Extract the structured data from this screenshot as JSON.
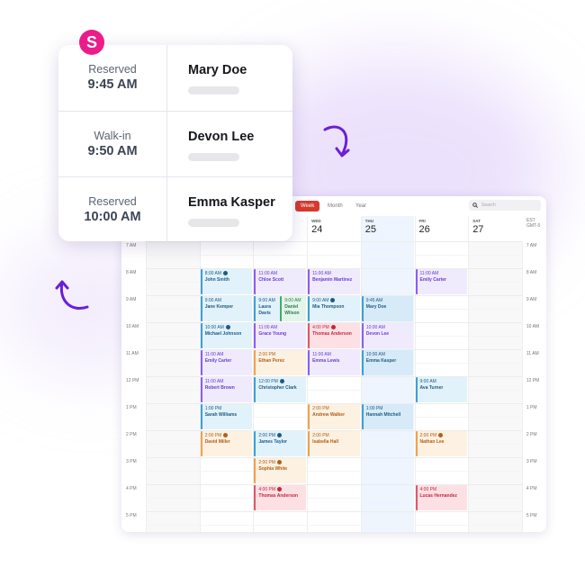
{
  "brand": {
    "logo_letter": "S",
    "logo_color": "#ec1c8a",
    "accent": "#6a1fd6"
  },
  "card": {
    "rows": [
      {
        "kind": "Reserved",
        "time": "9:45 AM",
        "name": "Mary Doe"
      },
      {
        "kind": "Walk-in",
        "time": "9:50 AM",
        "name": "Devon Lee"
      },
      {
        "kind": "Reserved",
        "time": "10:00 AM",
        "name": "Emma Kasper"
      }
    ]
  },
  "calendar": {
    "views": [
      {
        "label": "Week",
        "active": true
      },
      {
        "label": "Month"
      },
      {
        "label": "Year"
      }
    ],
    "search_placeholder": "Search",
    "timezone": [
      "EST",
      "GMT-5"
    ],
    "days": [
      {
        "name": "",
        "date": "",
        "shade": "grey"
      },
      {
        "name": "",
        "date": ""
      },
      {
        "name": "",
        "date": ""
      },
      {
        "name": "WED",
        "date": "24"
      },
      {
        "name": "THU",
        "date": "25",
        "today": true
      },
      {
        "name": "FRI",
        "date": "26"
      },
      {
        "name": "SAT",
        "date": "27",
        "shade": "grey"
      }
    ],
    "hours": [
      "7 AM",
      "8 AM",
      "9 AM",
      "10 AM",
      "11 AM",
      "12 PM",
      "1 PM",
      "2 PM",
      "3 PM",
      "4 PM",
      "5 PM"
    ],
    "colors": {
      "blue": {
        "bg": "#e1f2fb",
        "border": "#3d9fd8",
        "text": "#1f5a88"
      },
      "purple": {
        "bg": "#efeafc",
        "border": "#8b5cf6",
        "text": "#6a3fcf"
      },
      "orange": {
        "bg": "#fdf1e1",
        "border": "#efa14e",
        "text": "#b0601a"
      },
      "red": {
        "bg": "#fde0e4",
        "border": "#e0566a",
        "text": "#c0283d"
      },
      "green": {
        "bg": "#e3f5ea",
        "border": "#3fae6a",
        "text": "#2d7d4c"
      }
    },
    "events": [
      {
        "day": 1,
        "slot": "8 AM",
        "time": "8:00 AM",
        "name": "John Smith",
        "color": "blue",
        "icon": true
      },
      {
        "day": 1,
        "slot": "9 AM",
        "time": "9:00 AM",
        "name": "Jane Kemper",
        "color": "blue"
      },
      {
        "day": 1,
        "slot": "10 AM",
        "time": "10:00 AM",
        "name": "Michael Johnson",
        "color": "blue",
        "icon": true
      },
      {
        "day": 1,
        "slot": "11 AM",
        "time": "11:00 AM",
        "name": "Emily Carter",
        "color": "purple"
      },
      {
        "day": 1,
        "slot": "12 PM",
        "time": "11:00 AM",
        "name": "Robert Brown",
        "color": "purple"
      },
      {
        "day": 1,
        "slot": "1 PM",
        "time": "1:00 PM",
        "name": "Sarah Williams",
        "color": "blue"
      },
      {
        "day": 1,
        "slot": "2 PM",
        "time": "2:00 PM",
        "name": "David Miller",
        "color": "orange",
        "icon": true
      },
      {
        "day": 2,
        "slot": "8 AM",
        "time": "11:00 AM",
        "name": "Chloe Scott",
        "color": "purple"
      },
      {
        "day": 2,
        "slot": "9 AM",
        "time": "9:00 AM",
        "name": "Laura Davis",
        "color": "blue",
        "half": "left"
      },
      {
        "day": 2,
        "slot": "9 AM",
        "time": "9:00 AM",
        "name": "Daniel Wilson",
        "color": "green",
        "half": "right"
      },
      {
        "day": 2,
        "slot": "10 AM",
        "time": "11:00 AM",
        "name": "Grace Young",
        "color": "purple"
      },
      {
        "day": 2,
        "slot": "11 AM",
        "time": "2:00 PM",
        "name": "Ethan Perez",
        "color": "orange"
      },
      {
        "day": 2,
        "slot": "12 PM",
        "time": "12:00 PM",
        "name": "Christopher Clark",
        "color": "blue",
        "icon": true
      },
      {
        "day": 2,
        "slot": "2 PM",
        "time": "2:00 PM",
        "name": "James Taylor",
        "color": "blue",
        "icon": true
      },
      {
        "day": 2,
        "slot": "3 PM",
        "time": "2:00 PM",
        "name": "Sophia White",
        "color": "orange",
        "icon": true
      },
      {
        "day": 2,
        "slot": "4 PM",
        "time": "4:00 PM",
        "name": "Thomas Anderson",
        "color": "red",
        "icon": true
      },
      {
        "day": 3,
        "slot": "8 AM",
        "time": "11:00 AM",
        "name": "Benjamin Martinez",
        "color": "purple"
      },
      {
        "day": 3,
        "slot": "9 AM",
        "time": "9:00 AM",
        "name": "Mia Thompson",
        "color": "blue",
        "icon": true
      },
      {
        "day": 3,
        "slot": "10 AM",
        "time": "4:00 PM",
        "name": "Thomas Anderson",
        "color": "red",
        "icon": true
      },
      {
        "day": 3,
        "slot": "11 AM",
        "time": "11:00 AM",
        "name": "Emma Lewis",
        "color": "purple"
      },
      {
        "day": 3,
        "slot": "1 PM",
        "time": "2:00 PM",
        "name": "Andrew Walker",
        "color": "orange"
      },
      {
        "day": 3,
        "slot": "2 PM",
        "time": "2:00 PM",
        "name": "Isabella Hall",
        "color": "orange"
      },
      {
        "day": 4,
        "slot": "9 AM",
        "time": "9:45 AM",
        "name": "Mary Doe",
        "color": "blue"
      },
      {
        "day": 4,
        "slot": "10 AM",
        "time": "10:00 AM",
        "name": "Devon Lee",
        "color": "purple"
      },
      {
        "day": 4,
        "slot": "11 AM",
        "time": "10:00 AM",
        "name": "Emma Kasper",
        "color": "blue"
      },
      {
        "day": 4,
        "slot": "1 PM",
        "time": "1:00 PM",
        "name": "Hannah Mitchell",
        "color": "blue"
      },
      {
        "day": 5,
        "slot": "8 AM",
        "time": "11:00 AM",
        "name": "Emily Carter",
        "color": "purple"
      },
      {
        "day": 5,
        "slot": "12 PM",
        "time": "9:00 AM",
        "name": "Ava Turner",
        "color": "blue"
      },
      {
        "day": 5,
        "slot": "2 PM",
        "time": "2:00 PM",
        "name": "Nathan Lee",
        "color": "orange",
        "icon": true
      },
      {
        "day": 5,
        "slot": "4 PM",
        "time": "4:00 PM",
        "name": "Lucas Hernandez",
        "color": "red"
      }
    ]
  }
}
